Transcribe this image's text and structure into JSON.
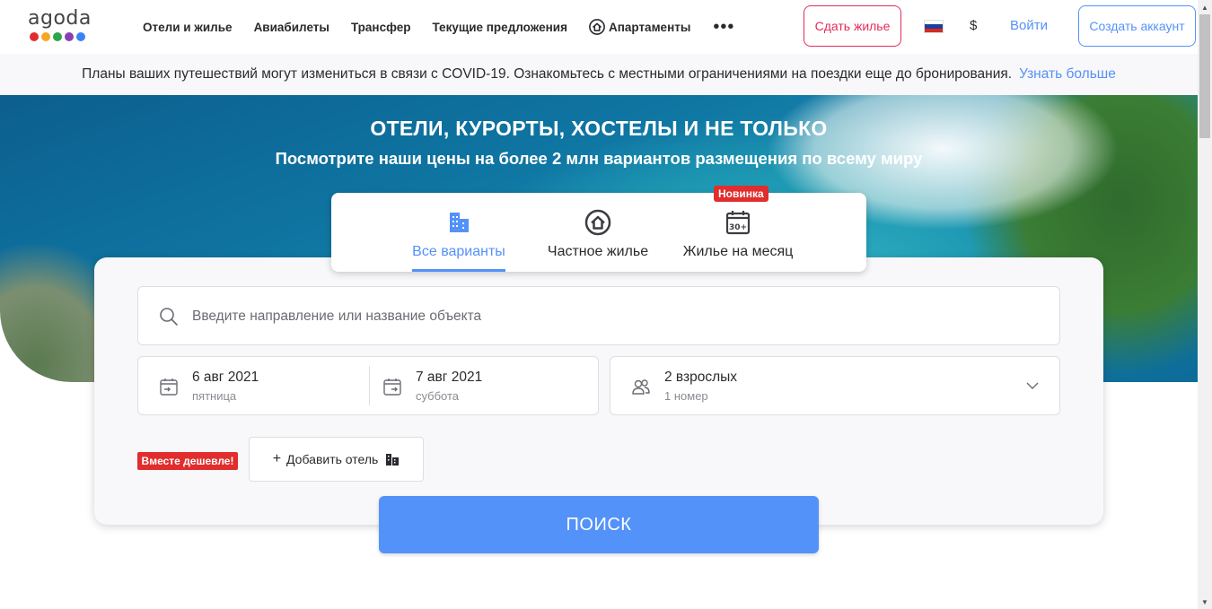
{
  "brand": {
    "logo_text": "agoda",
    "dot_colors": [
      "#e12d2d",
      "#f6a623",
      "#2ea44f",
      "#8c3fb2",
      "#3a82f7"
    ]
  },
  "nav": {
    "items": [
      {
        "label": "Отели и жилье"
      },
      {
        "label": "Авиабилеты"
      },
      {
        "label": "Трансфер"
      },
      {
        "label": "Текущие предложения"
      },
      {
        "label": "Апартаменты",
        "icon": "home-icon"
      }
    ],
    "more_label": "•••"
  },
  "header": {
    "host_button": "Сдать жилье",
    "language_icon": "russia-flag-icon",
    "currency": "$",
    "login": "Войти",
    "create_account": "Создать аккаунт"
  },
  "notice": {
    "text": "Планы ваших путешествий могут измениться в связи с COVID-19. Ознакомьтесь с местными ограничениями на поездки еще до бронирования.",
    "link": "Узнать больше"
  },
  "hero": {
    "title": "ОТЕЛИ, КУРОРТЫ, ХОСТЕЛЫ И НЕ ТОЛЬКО",
    "subtitle": "Посмотрите наши цены на более 2 млн вариантов размещения по всему миру"
  },
  "tabs": [
    {
      "label": "Все варианты",
      "icon": "building-icon",
      "active": true
    },
    {
      "label": "Частное жилье",
      "icon": "home-circle-icon",
      "active": false
    },
    {
      "label": "Жилье на месяц",
      "icon": "calendar-30-icon",
      "active": false
    }
  ],
  "new_badge": "Новинка",
  "search": {
    "placeholder": "Введите направление или название объекта"
  },
  "dates": {
    "checkin": {
      "date": "6 авг 2021",
      "weekday": "пятница"
    },
    "checkout": {
      "date": "7 авг 2021",
      "weekday": "суббота"
    }
  },
  "guests": {
    "main": "2 взрослых",
    "sub": "1 номер"
  },
  "bundle": {
    "badge": "Вместе дешевле!",
    "add_hotel": "Добавить отель",
    "plus": "+"
  },
  "search_button": "ПОИСК",
  "colors": {
    "accent": "#5392f9",
    "host": "#e12d5a",
    "badge": "#e12d2d"
  }
}
